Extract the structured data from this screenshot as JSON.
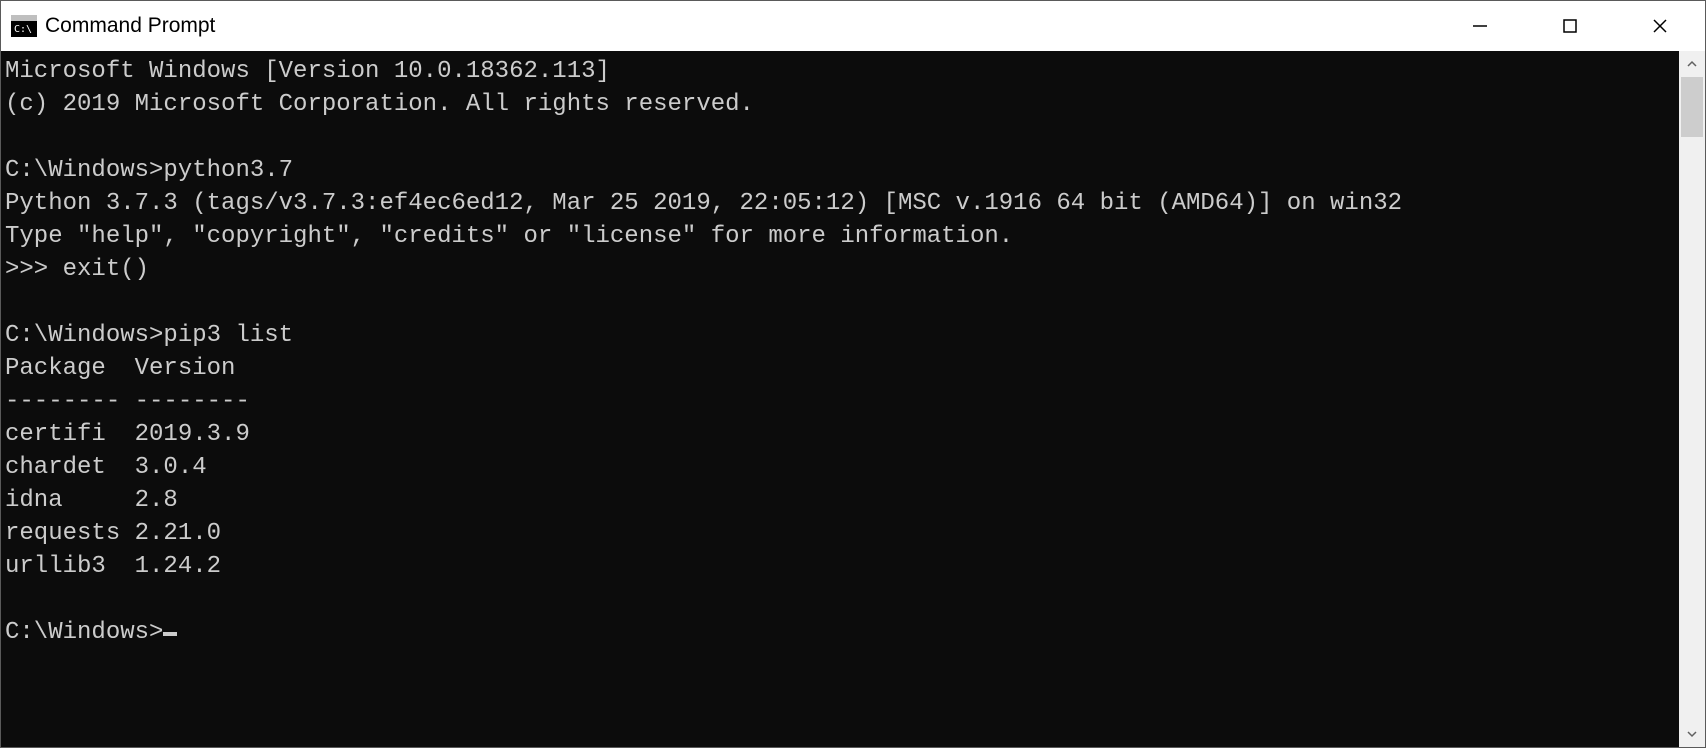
{
  "titlebar": {
    "title": "Command Prompt"
  },
  "terminal": {
    "lines": [
      "Microsoft Windows [Version 10.0.18362.113]",
      "(c) 2019 Microsoft Corporation. All rights reserved.",
      "",
      "C:\\Windows>python3.7",
      "Python 3.7.3 (tags/v3.7.3:ef4ec6ed12, Mar 25 2019, 22:05:12) [MSC v.1916 64 bit (AMD64)] on win32",
      "Type \"help\", \"copyright\", \"credits\" or \"license\" for more information.",
      ">>> exit()",
      "",
      "C:\\Windows>pip3 list",
      "Package  Version",
      "-------- --------",
      "certifi  2019.3.9",
      "chardet  3.0.4",
      "idna     2.8",
      "requests 2.21.0",
      "urllib3  1.24.2",
      ""
    ],
    "prompt": "C:\\Windows>"
  }
}
